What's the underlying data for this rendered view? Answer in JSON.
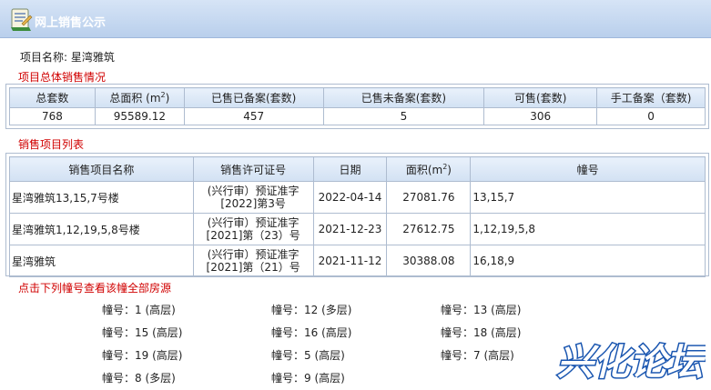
{
  "header": {
    "title": "网上销售公示"
  },
  "project": {
    "label": "项目名称:",
    "name": "星湾雅筑"
  },
  "summary": {
    "section_title": "项目总体销售情况",
    "headers": [
      "总套数",
      "总面积 (m",
      "已售已备案(套数)",
      "已售未备案(套数)",
      "可售(套数)",
      "手工备案（套数)"
    ],
    "area_sup": "2",
    "area_close": ")",
    "values": [
      "768",
      "95589.12",
      "457",
      "5",
      "306",
      "0"
    ]
  },
  "sales_list": {
    "section_title": "销售项目列表",
    "headers": [
      "销售项目名称",
      "销售许可证号",
      "日期",
      "面积(m",
      "幢号"
    ],
    "area_sup": "2",
    "area_close": ")",
    "rows": [
      {
        "name": "星湾雅筑13,15,7号楼",
        "cert_line1": "(兴行审）预证准字",
        "cert_line2": "[2022]第3号",
        "date": "2022-04-14",
        "area": "27081.76",
        "buildings": "13,15,7"
      },
      {
        "name": "星湾雅筑1,12,19,5,8号楼",
        "cert_line1": "(兴行审）预证准字",
        "cert_line2": "[2021]第（23）号",
        "date": "2021-12-23",
        "area": "27612.75",
        "buildings": "1,12,19,5,8"
      },
      {
        "name": "星湾雅筑",
        "cert_line1": "(兴行审）预证准字",
        "cert_line2": "[2021]第（21）号",
        "date": "2021-11-12",
        "area": "30388.08",
        "buildings": "16,18,9"
      }
    ]
  },
  "buildings": {
    "section_title": "点击下列幢号查看该幢全部房源",
    "items": [
      "幢号：1 (高层)",
      "幢号：12 (多层)",
      "幢号：13 (高层)",
      "幢号：15 (高层)",
      "幢号：16 (高层)",
      "幢号：18 (高层)",
      "幢号：19 (高层)",
      "幢号：5 (高层)",
      "幢号：7 (高层)",
      "幢号：8 (多层)",
      "幢号：9 (高层)"
    ]
  },
  "watermark": {
    "text": "兴化论坛"
  }
}
